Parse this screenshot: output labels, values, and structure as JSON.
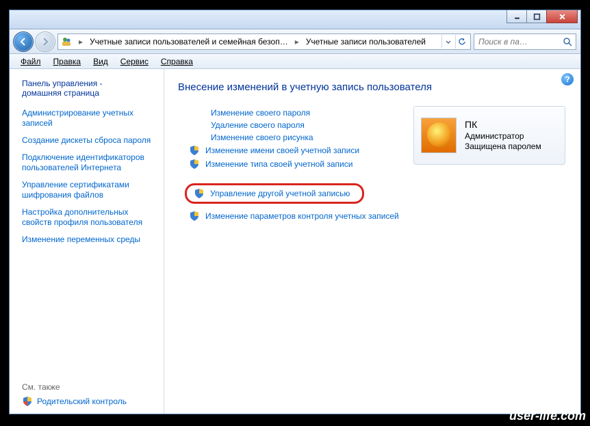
{
  "breadcrumb": {
    "seg1": "Учетные записи пользователей и семейная безоп…",
    "seg2": "Учетные записи пользователей"
  },
  "search": {
    "placeholder": "Поиск в па…"
  },
  "menu": {
    "file": "Файл",
    "edit": "Правка",
    "view": "Вид",
    "tools": "Сервис",
    "help": "Справка"
  },
  "sidebar": {
    "heading_l1": "Панель управления -",
    "heading_l2": "домашняя страница",
    "links": [
      "Администрирование учетных записей",
      "Создание дискеты сброса пароля",
      "Подключение идентификаторов пользователей Интернета",
      "Управление сертификатами шифрования файлов",
      "Настройка дополнительных свойств профиля пользователя",
      "Изменение переменных среды"
    ],
    "see_also": "См. также",
    "parental": "Родительский контроль"
  },
  "main": {
    "title": "Внесение изменений в учетную запись пользователя",
    "tasks_plain": [
      "Изменение своего пароля",
      "Удаление своего пароля",
      "Изменение своего рисунка"
    ],
    "tasks_shield": [
      "Изменение имени своей учетной записи",
      "Изменение типа своей учетной записи"
    ],
    "task_highlight": "Управление другой учетной записью",
    "task_after": "Изменение параметров контроля учетных записей"
  },
  "account": {
    "name": "ПК",
    "role": "Администратор",
    "pw": "Защищена паролем"
  },
  "watermark": "user-life.com"
}
